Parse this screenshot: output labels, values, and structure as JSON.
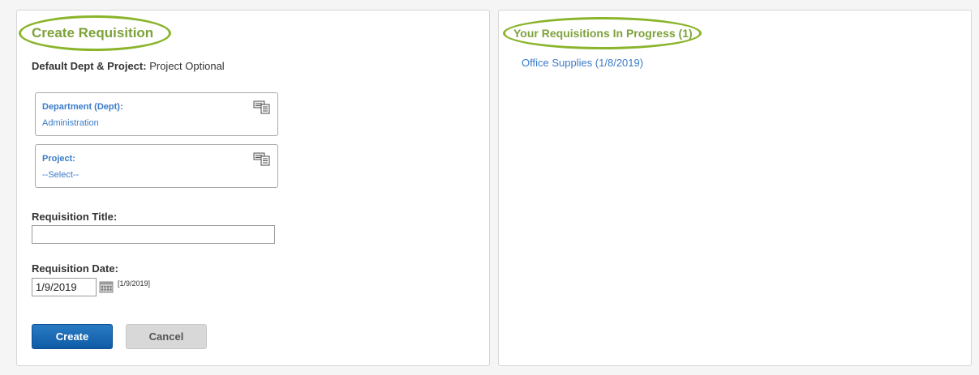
{
  "create_panel": {
    "title": "Create Requisition",
    "default_label": "Default Dept & Project:",
    "default_value": "Project Optional",
    "department": {
      "label": "Department (Dept):",
      "value": "Administration"
    },
    "project": {
      "label": "Project:",
      "value": "--Select--"
    },
    "title_field": {
      "label": "Requisition Title:",
      "value": ""
    },
    "date_field": {
      "label": "Requisition Date:",
      "value": "1/9/2019",
      "hint": "[1/9/2019]"
    },
    "create_label": "Create",
    "cancel_label": "Cancel"
  },
  "progress_panel": {
    "title": "Your Requisitions In Progress (1)",
    "items": [
      {
        "label": "Office Supplies (1/8/2019)"
      }
    ]
  },
  "colors": {
    "accent_green": "#8ab42a",
    "title_green": "#7ea23a",
    "link_blue": "#3a7bc8",
    "primary_button": "#1a6bb8"
  },
  "icons": {
    "chooser": "form-list-icon",
    "calendar": "calendar-icon"
  }
}
